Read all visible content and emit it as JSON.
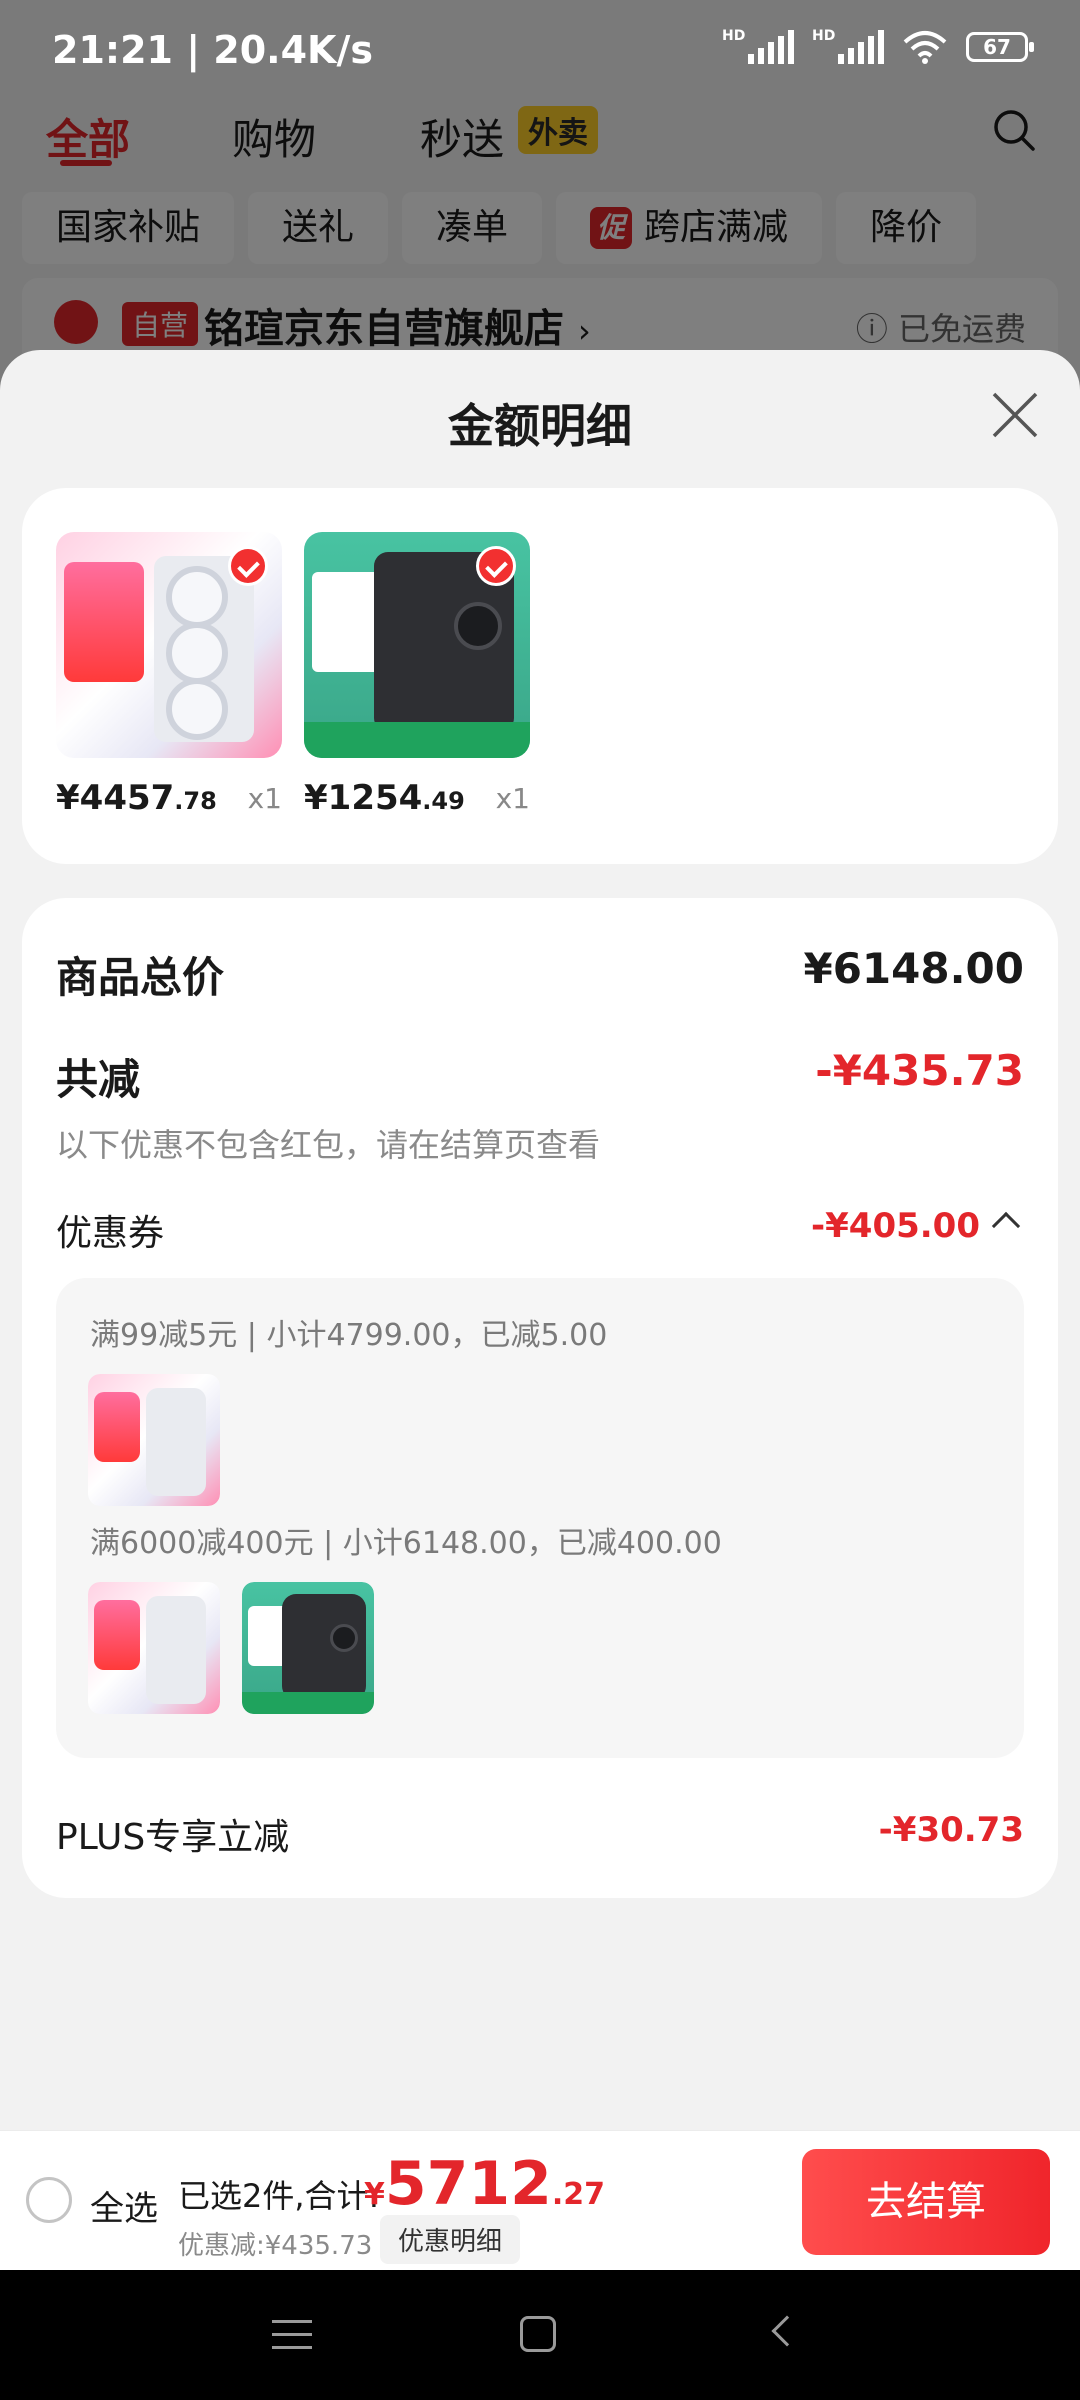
{
  "status_bar": {
    "time_speed": "21:21 | 20.4K/s",
    "battery": "67",
    "signal1": "HD",
    "signal2": "HD"
  },
  "top_tabs": [
    {
      "label": "全部"
    },
    {
      "label": "购物"
    },
    {
      "label": "秒送"
    }
  ],
  "top_badge": "外卖",
  "filter_chips": [
    "国家补贴",
    "送礼",
    "凑单",
    "跨店满减",
    "降价"
  ],
  "promo_icon_text": "促",
  "shop": {
    "tag": "自营",
    "name": "铭瑄京东自营旗舰店",
    "arrow": "›",
    "shipping": "ⓘ 已免运费"
  },
  "sheet": {
    "title": "金额明细",
    "products": [
      {
        "price_int": "¥4457",
        "price_dec": ".78",
        "qty": "x1",
        "icon": "graphics-card"
      },
      {
        "price_int": "¥1254",
        "price_dec": ".49",
        "qty": "x1",
        "icon": "speaker"
      }
    ],
    "summary": {
      "total_label": "商品总价",
      "total_value": "¥6148.00",
      "discount_label": "共减",
      "discount_value": "-¥435.73",
      "note": "以下优惠不包含红包，请在结算页查看",
      "coupon_label": "优惠券",
      "coupon_value": "-¥405.00",
      "coupon_rules": [
        "满99减5元 | 小计4799.00，已减5.00",
        "满6000减400元 | 小计6148.00，已减400.00"
      ],
      "plus_label": "PLUS专享立减",
      "plus_value": "-¥30.73"
    }
  },
  "checkout": {
    "select_all": "全选",
    "selected_text": "已选2件,合计:",
    "total_yen": "¥",
    "total_int": "5712",
    "total_dec": ".27",
    "discount_text": "优惠减:¥435.73",
    "detail_button": "优惠明细",
    "pay_button": "去结算"
  },
  "colors": {
    "accent": "#e3262b",
    "sheet_bg": "#f2f2f2"
  }
}
